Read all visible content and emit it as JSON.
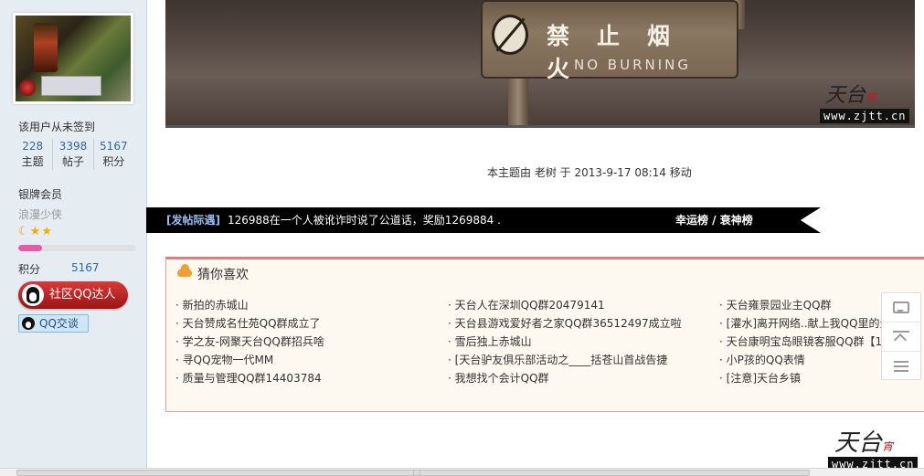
{
  "user": {
    "sign_status": "该用户从未签到",
    "stats": [
      {
        "value": "228",
        "label": "主题"
      },
      {
        "value": "3398",
        "label": "帖子"
      },
      {
        "value": "5167",
        "label": "积分"
      }
    ],
    "group": "银牌会员",
    "title": "浪漫少侠",
    "level_progress_percent": 20,
    "credit_label": "积分",
    "credit_value": "5167",
    "qq_master_label": "社区QQ达人",
    "qq_chat_label": "QQ交谈",
    "icons": [
      "avatar-image",
      "moon-icon",
      "star-icon",
      "qq-penguin-icon"
    ]
  },
  "photo": {
    "sign_cn": "禁止烟火",
    "sign_en": "NO BURNING",
    "watermark_logo": "天台",
    "watermark_logo_mark": "宵",
    "watermark_url": "www.zjtt.cn"
  },
  "post": {
    "meta": "本主题由 老树 于 2013-9-17 08:14 移动"
  },
  "notice": {
    "tag": "[发帖际遇]",
    "text": "126988在一个人被讹诈时说了公道话，奖励1269884 .",
    "links": "幸运榜 / 衰神榜"
  },
  "recommend": {
    "title": "猜你喜欢",
    "columns": [
      [
        "新拍的赤城山",
        "天台赞成名仕苑QQ群成立了",
        "学之友-网聚天台QQ群招兵啥",
        "寻QQ宠物一代MM",
        "质量与管理QQ群14403784"
      ],
      [
        "天台人在深圳QQ群20479141",
        "天台县游戏爱好者之家QQ群36512497成立啦",
        "雪后独上赤城山",
        "[天台驴友俱乐部活动之____括苍山首战告捷",
        "我想找个会计QQ群"
      ],
      [
        "天台雍景园业主QQ群",
        "[灌水]离开网络..献上我QQ里的无",
        "天台康明宝岛眼镜客服QQ群【1",
        "小P孩的QQ表情",
        "[注意]天台乡镇"
      ]
    ]
  },
  "floatbar": {
    "icons": [
      "comment-icon",
      "back-to-top-icon",
      "list-icon"
    ]
  },
  "bottom_watermark": {
    "logo": "天台",
    "logo_mark": "宵",
    "url": "www.zjtt.cn"
  },
  "colors": {
    "sidebar_bg": "#e5edf2",
    "notice_bg": "#000000",
    "notice_tag": "#9bbcf0",
    "recommend_border": "#e07c7c",
    "link_blue": "#336699",
    "qq_red": "#c82424"
  }
}
